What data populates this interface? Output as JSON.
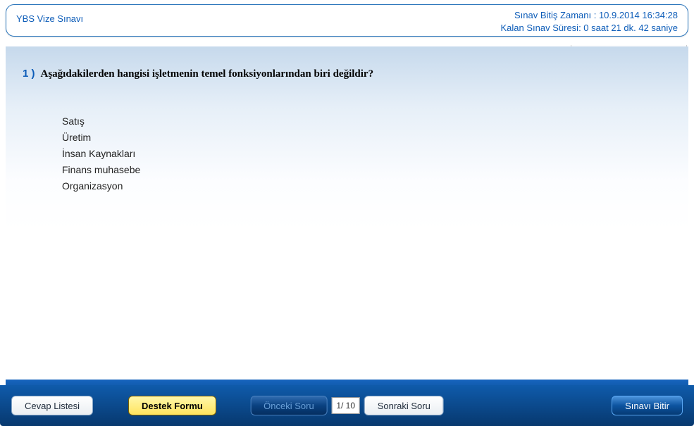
{
  "header": {
    "title": "YBS Vize Sınavı",
    "end_time_label": "Sınav Bitiş Zamanı : 10.9.2014 16:34:28",
    "remaining_label": "Kalan Sınav Süresi: 0 saat 21 dk. 42 saniye"
  },
  "question": {
    "number": "1 )",
    "text": "Aşağıdakilerden hangisi işletmenin temel fonksiyonlarından biri değildir?",
    "options": [
      "Satış",
      "Üretim",
      "İnsan Kaynakları",
      "Finans muhasebe",
      "Organizasyon"
    ]
  },
  "footer": {
    "answers_list": "Cevap Listesi",
    "support_form": "Destek Formu",
    "prev": "Önceki Soru",
    "pager": "1/ 10",
    "next": "Sonraki Soru",
    "finish": "Sınavı Bitir"
  }
}
